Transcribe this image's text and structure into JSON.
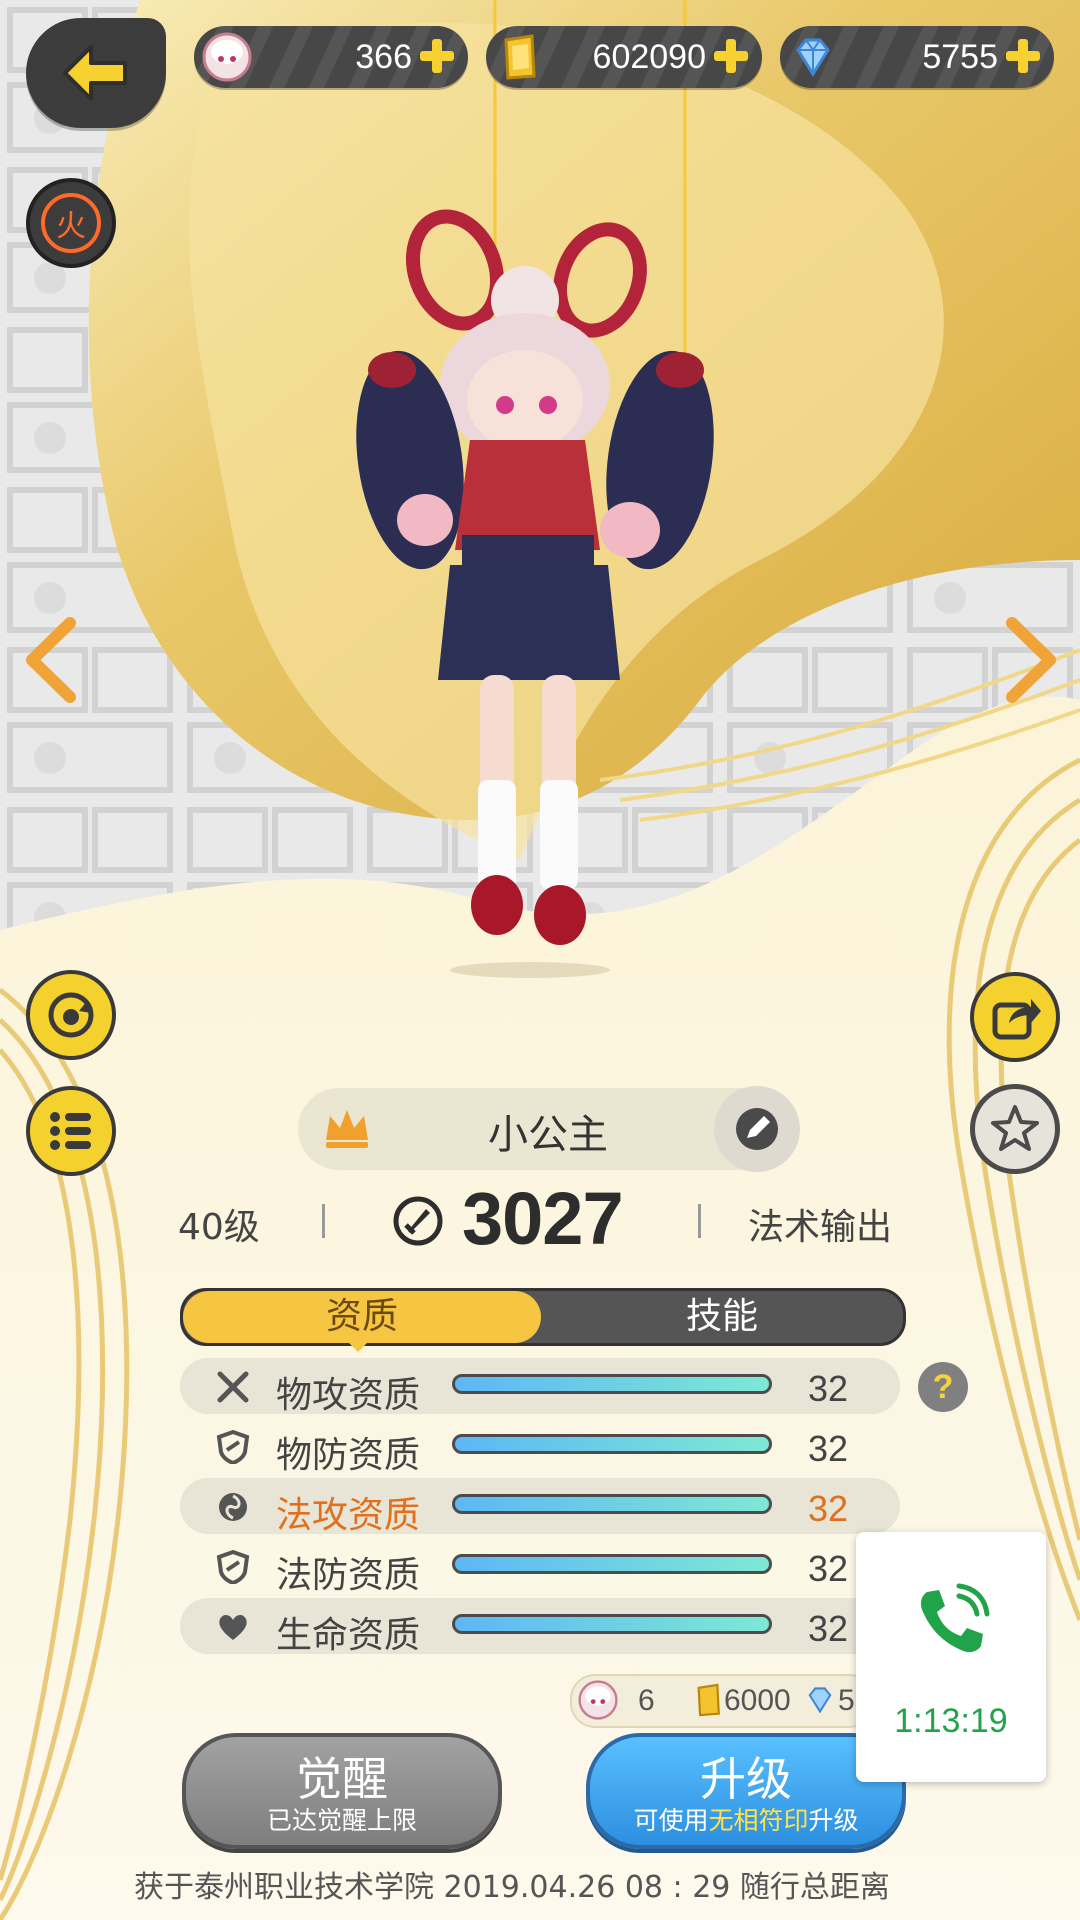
{
  "resources": [
    {
      "icon": "stamina-face-icon",
      "value": "366"
    },
    {
      "icon": "gold-ingot-icon",
      "value": "602090"
    },
    {
      "icon": "diamond-icon",
      "value": "5755"
    }
  ],
  "element_badge": "火",
  "character": {
    "name": "小公主",
    "level": "40级",
    "power": "3027",
    "role": "法术输出"
  },
  "tabs": [
    {
      "label": "资质",
      "active": true
    },
    {
      "label": "技能",
      "active": false
    }
  ],
  "stats": [
    {
      "label": "物攻资质",
      "value": "32",
      "icon": "crossed-swords-icon",
      "highlight": false
    },
    {
      "label": "物防资质",
      "value": "32",
      "icon": "shield-icon",
      "highlight": false
    },
    {
      "label": "法攻资质",
      "value": "32",
      "icon": "magic-swirl-icon",
      "highlight": true
    },
    {
      "label": "法防资质",
      "value": "32",
      "icon": "magic-shield-icon",
      "highlight": false
    },
    {
      "label": "生命资质",
      "value": "32",
      "icon": "heart-icon",
      "highlight": false
    }
  ],
  "stat_fill_fraction": 1.0,
  "help_label": "?",
  "cost": {
    "face_qty": "6",
    "gold_qty": "6000",
    "diamond_qty": "5"
  },
  "buttons": {
    "awaken_label": "觉醒",
    "awaken_sub": "已达觉醒上限",
    "upgrade_label": "升级",
    "upgrade_sub_pre": "可使用",
    "upgrade_sub_hl": "无相符印",
    "upgrade_sub_post": "升级"
  },
  "footer": {
    "text": "获于泰州职业技术学院  2019.04.26   08 : 29   随行总距离"
  },
  "call_overlay": {
    "timer": "1:13:19"
  },
  "colors": {
    "accent_yellow": "#f6c541",
    "highlight_orange": "#e0701c",
    "upgrade_blue": "#2d8fe0",
    "call_green": "#21a34a"
  }
}
